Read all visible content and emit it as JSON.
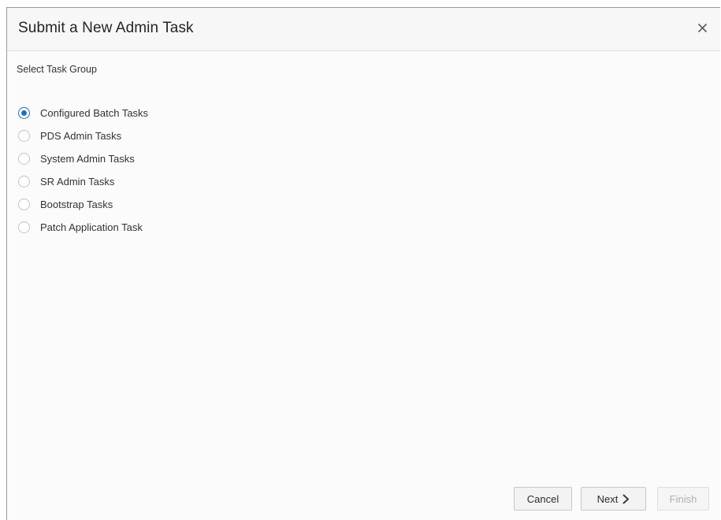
{
  "dialog": {
    "title": "Submit a New Admin Task",
    "close_icon": "close-icon"
  },
  "body": {
    "section_label": "Select Task Group",
    "selected_index": 0,
    "options": [
      {
        "label": "Configured Batch Tasks",
        "checked": true
      },
      {
        "label": "PDS Admin Tasks",
        "checked": false
      },
      {
        "label": "System Admin Tasks",
        "checked": false
      },
      {
        "label": "SR Admin Tasks",
        "checked": false
      },
      {
        "label": "Bootstrap Tasks",
        "checked": false
      },
      {
        "label": "Patch Application Task",
        "checked": false
      }
    ]
  },
  "footer": {
    "cancel_label": "Cancel",
    "next_label": "Next",
    "next_icon": "chevron-right-icon",
    "finish_label": "Finish",
    "finish_enabled": false
  },
  "colors": {
    "accent": "#1a70c2",
    "header_bg": "#f7f7f7",
    "disabled_text": "#b0b0b0"
  }
}
